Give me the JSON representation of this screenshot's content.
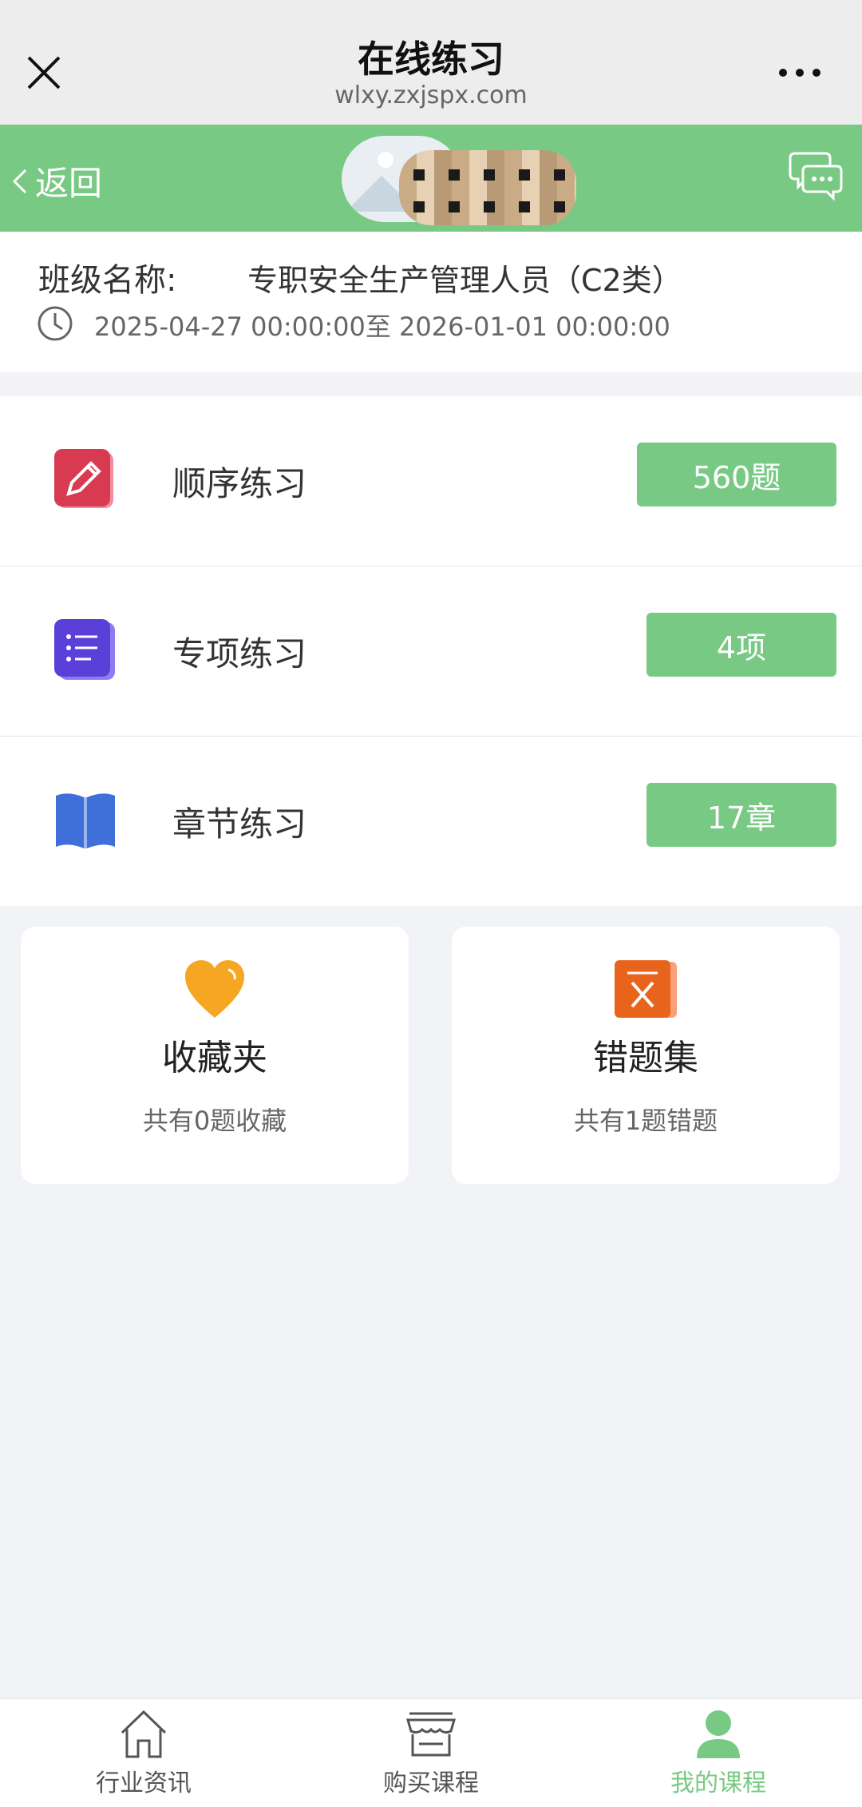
{
  "topbar": {
    "title": "在线练习",
    "url": "wlxy.zxjspx.com"
  },
  "header": {
    "back_label": "返回"
  },
  "class_info": {
    "label": "班级名称:",
    "name": "专职安全生产管理人员（C2类）",
    "dates": "2025-04-27 00:00:00至 2026-01-01 00:00:00"
  },
  "practice": [
    {
      "label": "顺序练习",
      "badge": "560题",
      "icon": "pencil-icon"
    },
    {
      "label": "专项练习",
      "badge": "4项",
      "icon": "list-icon"
    },
    {
      "label": "章节练习",
      "badge": "17章",
      "icon": "book-icon"
    }
  ],
  "cards": {
    "favorites": {
      "title": "收藏夹",
      "subtitle": "共有0题收藏"
    },
    "mistakes": {
      "title": "错题集",
      "subtitle": "共有1题错题"
    }
  },
  "tabbar": [
    {
      "label": "行业资讯",
      "icon": "home-icon"
    },
    {
      "label": "购买课程",
      "icon": "store-icon"
    },
    {
      "label": "我的课程",
      "icon": "user-icon",
      "active": true
    }
  ],
  "colors": {
    "accent": "#78c984",
    "background": "#f2f3f7"
  }
}
